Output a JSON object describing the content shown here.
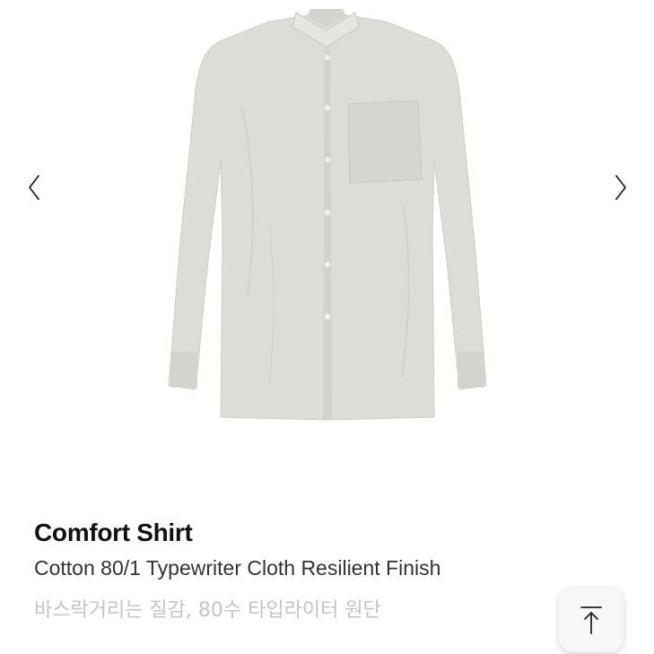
{
  "gallery": {
    "image_subject": "shirt",
    "prev_icon": "chevron-left-icon",
    "next_icon": "chevron-right-icon"
  },
  "product": {
    "title": "Comfort Shirt",
    "subtitle": "Cotton 80/1 Typewriter Cloth Resilient Finish",
    "description": "바스락거리는 질감, 80수 타입라이터 원단"
  },
  "scroll_top": {
    "icon": "arrow-up-to-top-icon"
  },
  "colors": {
    "shirt": "#dcdbd6",
    "title": "#111111",
    "subtitle": "#333333",
    "description": "#c4c4c4"
  }
}
